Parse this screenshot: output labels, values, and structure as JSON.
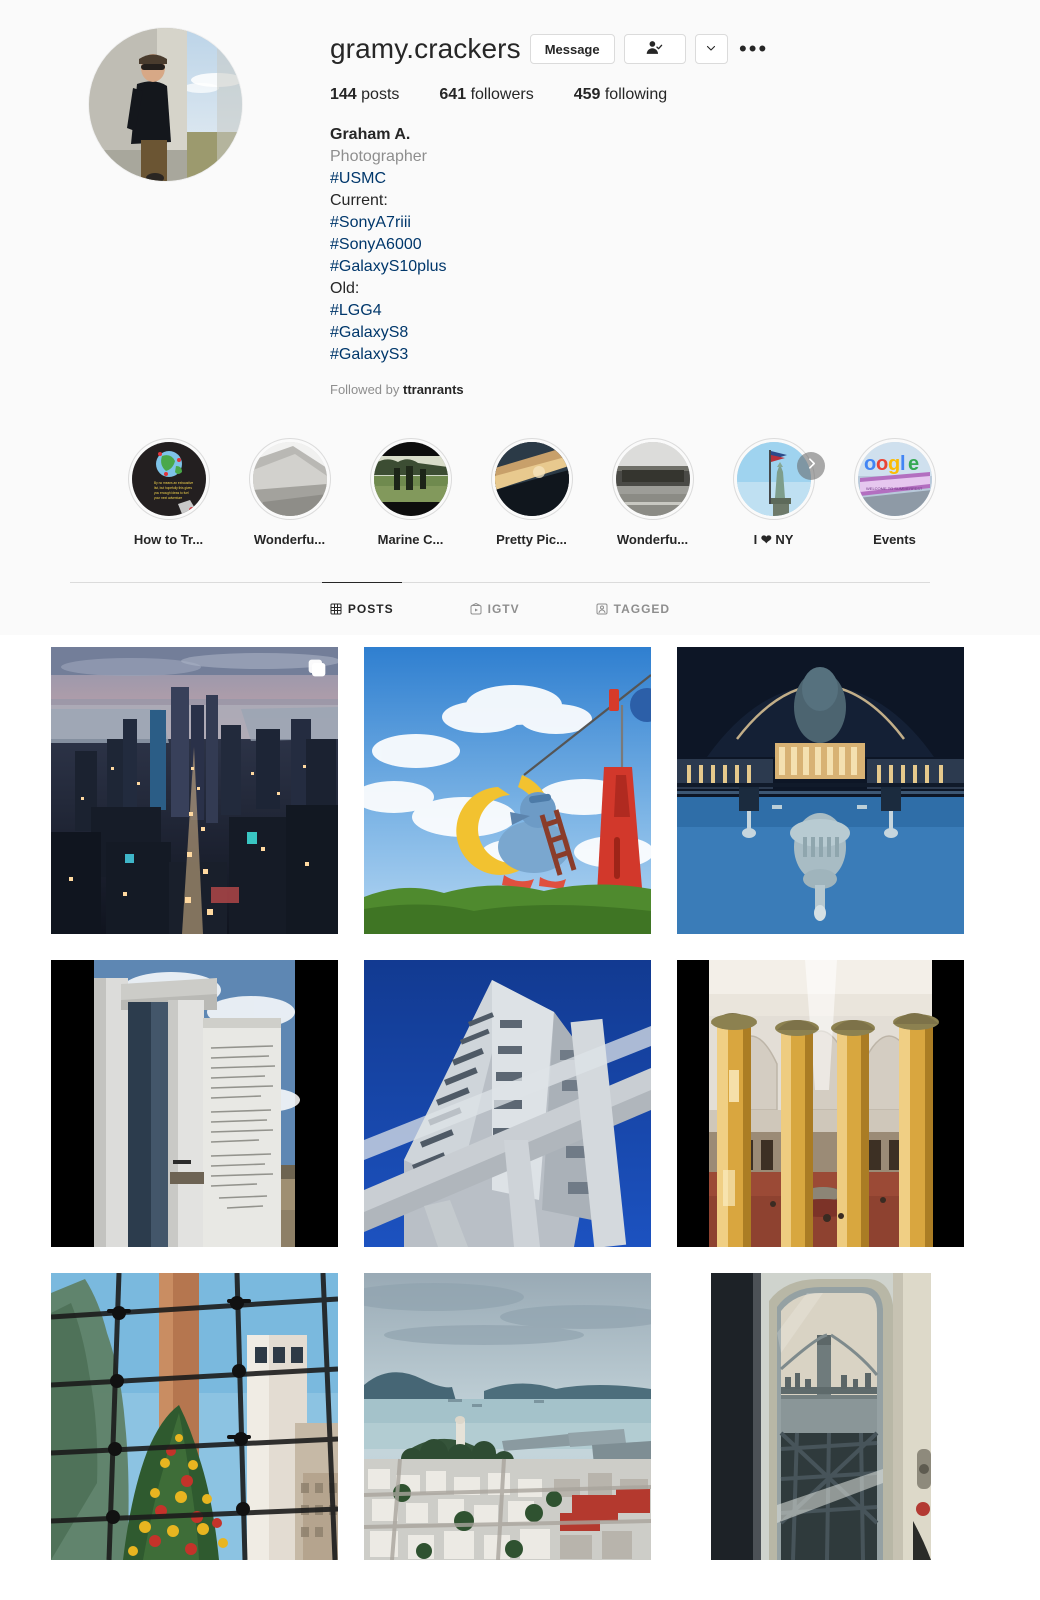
{
  "profile": {
    "username": "gramy.crackers",
    "avatar_alt": "profile-photo",
    "actions": {
      "message_label": "Message",
      "following_icon": "person-check-icon",
      "caret_icon": "chevron-down-icon",
      "more_icon": "more-options-icon",
      "more_glyph": "•••"
    },
    "stats": [
      {
        "count": "144",
        "label": "posts"
      },
      {
        "count": "641",
        "label": "followers"
      },
      {
        "count": "459",
        "label": "following"
      }
    ],
    "bio": {
      "full_name": "Graham A.",
      "category": "Photographer",
      "lines": [
        {
          "text": "#USMC",
          "type": "tag"
        },
        {
          "text": "Current:",
          "type": "plain"
        },
        {
          "text": "#SonyA7riii",
          "type": "tag"
        },
        {
          "text": "#SonyA6000",
          "type": "tag"
        },
        {
          "text": "#GalaxyS10plus",
          "type": "tag"
        },
        {
          "text": "Old:",
          "type": "plain"
        },
        {
          "text": "#LGG4",
          "type": "tag"
        },
        {
          "text": "#GalaxyS8",
          "type": "tag"
        },
        {
          "text": "#GalaxyS3",
          "type": "tag"
        }
      ]
    },
    "followed_by_prefix": "Followed by ",
    "followed_by_names": "ttranrants"
  },
  "highlights": {
    "next_icon": "chevron-right-icon",
    "items": [
      {
        "label": "How to Tr...",
        "art": "travel-globe"
      },
      {
        "label": "Wonderfu...",
        "art": "monument-stone"
      },
      {
        "label": "Marine C...",
        "art": "field-soldiers"
      },
      {
        "label": "Pretty Pic...",
        "art": "sunset-rail"
      },
      {
        "label": "Wonderfu...",
        "art": "roadside-building"
      },
      {
        "label": "I ❤ NY",
        "art": "liberty-flag"
      },
      {
        "label": "Events",
        "art": "google-sign"
      }
    ]
  },
  "tabs": [
    {
      "label": "POSTS",
      "icon": "grid-icon",
      "active": true
    },
    {
      "label": "IGTV",
      "icon": "igtv-icon",
      "active": false
    },
    {
      "label": "TAGGED",
      "icon": "tagged-icon",
      "active": false
    }
  ],
  "grid": {
    "posts": [
      {
        "alt": "nyc-skyline-dusk",
        "art": "nyc-dusk",
        "carousel": true
      },
      {
        "alt": "duck-sculpture-sky",
        "art": "duck-sculpture",
        "carousel": false
      },
      {
        "alt": "us-capitol-reflection-inverted",
        "art": "capitol-reflection",
        "carousel": false
      },
      {
        "alt": "georgia-guidestones",
        "art": "guidestones",
        "carousel": false
      },
      {
        "alt": "modern-tower-upward",
        "art": "tower-upward",
        "carousel": false
      },
      {
        "alt": "national-building-museum-columns",
        "art": "museum-columns",
        "carousel": false
      },
      {
        "alt": "christmas-tree-through-glass",
        "art": "christmas-tree",
        "carousel": false
      },
      {
        "alt": "san-francisco-bay-coit-tower",
        "art": "sf-bay",
        "carousel": false
      },
      {
        "alt": "bridge-through-train-window",
        "art": "train-window",
        "carousel": false
      }
    ]
  },
  "colors": {
    "link": "#00376b",
    "muted": "#8e8e8e",
    "text": "#262626",
    "border": "#dbdbdb",
    "header_bg": "#fafafa"
  }
}
